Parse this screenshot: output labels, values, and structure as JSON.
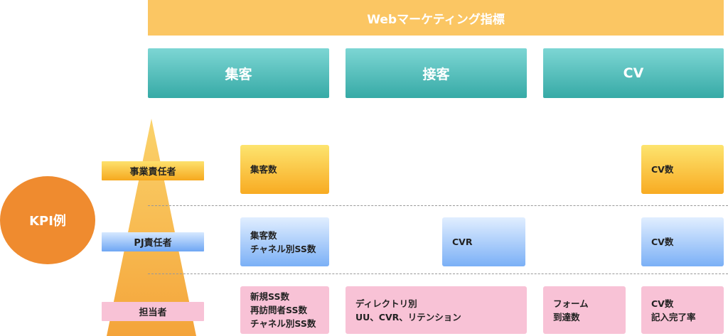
{
  "header": {
    "title": "Webマーケティング指標"
  },
  "categories": [
    "集客",
    "接客",
    "CV"
  ],
  "kpi_label": "KPI例",
  "roles": {
    "executive": "事業責任者",
    "pj_lead": "PJ責任者",
    "staff": "担当者"
  },
  "cells": {
    "executive": {
      "acquisition": [
        "集客数"
      ],
      "cv": [
        "CV数"
      ]
    },
    "pj_lead": {
      "acquisition": [
        "集客数",
        "チャネル別SS数"
      ],
      "engagement": [
        "CVR"
      ],
      "cv": [
        "CV数"
      ]
    },
    "staff": {
      "acquisition": [
        "新規SS数",
        "再訪問者SS数",
        "チャネル別SS数"
      ],
      "engagement": [
        "ディレクトリ別",
        "UU、CVR、リテンション"
      ],
      "form": [
        "フォーム",
        "到達数"
      ],
      "cv": [
        "CV数",
        "記入完了率"
      ]
    }
  },
  "colors": {
    "banner": "#fbc663",
    "category": "#36aaa6",
    "kpi_circle": "#ef8b2f",
    "executive": "#f6a81e",
    "pj_lead": "#6ea6f4",
    "staff": "#f8c2d6"
  }
}
